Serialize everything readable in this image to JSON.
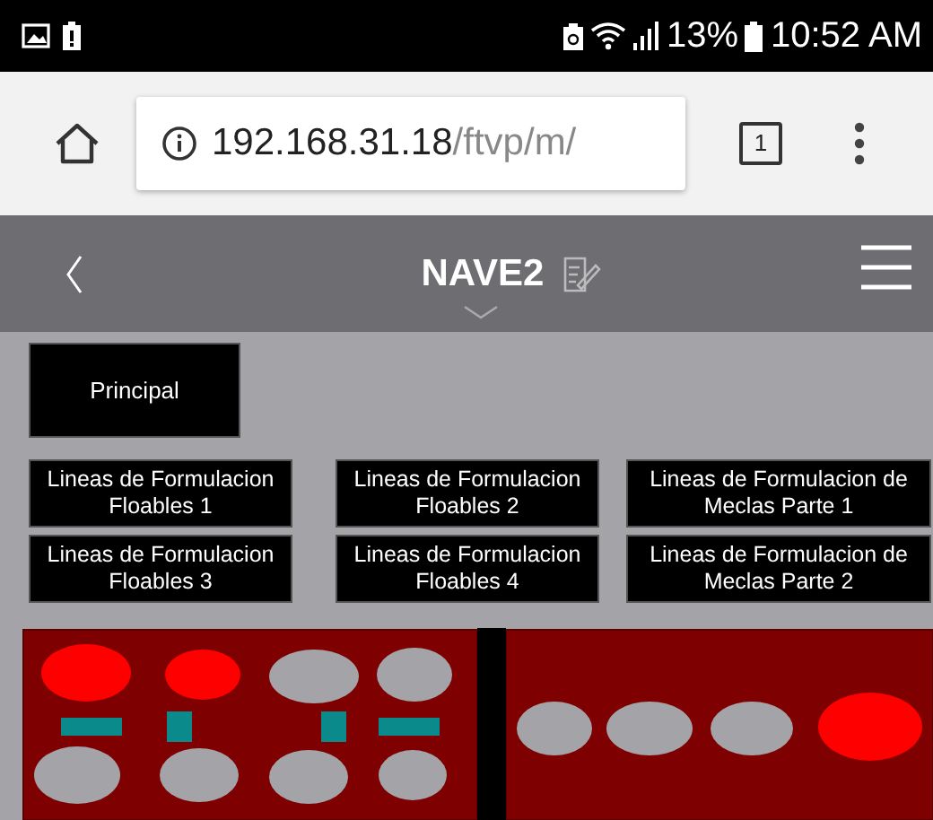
{
  "status_bar": {
    "battery_percent": "13%",
    "time": "10:52 AM"
  },
  "browser": {
    "url_host": "192.168.31.18",
    "url_path": "/ftvp/m/",
    "tab_count": "1"
  },
  "header": {
    "title": "NAVE2"
  },
  "main_button": "Principal",
  "line_buttons": [
    {
      "label": "Lineas de Formulacion Floables 1"
    },
    {
      "label": "Lineas de Formulacion Floables 2"
    },
    {
      "label": "Lineas de Formulacion de Meclas Parte 1"
    },
    {
      "label": "Lineas de Formulacion Floables 3"
    },
    {
      "label": "Lineas de Formulacion Floables 4"
    },
    {
      "label": "Lineas de Formulacion de Meclas Parte 2"
    }
  ],
  "diagram": {
    "left_top_lamps": [
      {
        "on": true
      },
      {
        "on": true
      },
      {
        "on": false
      },
      {
        "on": false
      }
    ],
    "valves": [
      {
        "kind": "horizontal"
      },
      {
        "kind": "vertical"
      },
      {
        "kind": "vertical"
      },
      {
        "kind": "horizontal"
      }
    ],
    "left_bottom_lamps": [
      {
        "on": false
      },
      {
        "on": false
      },
      {
        "on": false
      },
      {
        "on": false
      }
    ],
    "right_lamps": [
      {
        "on": false
      },
      {
        "on": false
      },
      {
        "on": false
      },
      {
        "on": true
      }
    ]
  }
}
